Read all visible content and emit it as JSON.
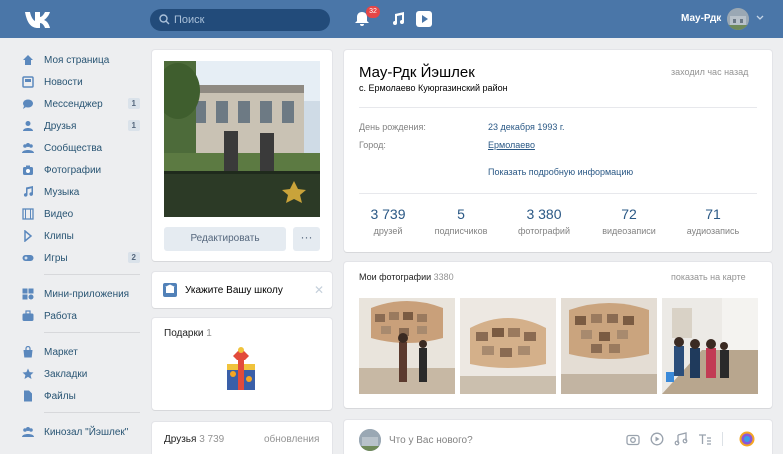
{
  "header": {
    "logo": "vk-logo",
    "search_placeholder": "Поиск",
    "notification_count": "32",
    "user_name": "Мау-Рдк"
  },
  "sidebar": {
    "items": [
      {
        "label": "Моя страница",
        "icon": "home-icon"
      },
      {
        "label": "Новости",
        "icon": "news-icon"
      },
      {
        "label": "Мессенджер",
        "icon": "message-icon",
        "count": "1"
      },
      {
        "label": "Друзья",
        "icon": "friends-icon",
        "count": "1"
      },
      {
        "label": "Сообщества",
        "icon": "communities-icon"
      },
      {
        "label": "Фотографии",
        "icon": "camera-icon"
      },
      {
        "label": "Музыка",
        "icon": "music-icon"
      },
      {
        "label": "Видео",
        "icon": "video-icon"
      },
      {
        "label": "Клипы",
        "icon": "clips-icon"
      },
      {
        "label": "Игры",
        "icon": "games-icon",
        "count": "2"
      },
      {
        "label": "Мини-приложения",
        "icon": "apps-icon"
      },
      {
        "label": "Работа",
        "icon": "briefcase-icon"
      },
      {
        "label": "Маркет",
        "icon": "market-icon"
      },
      {
        "label": "Закладки",
        "icon": "star-icon"
      },
      {
        "label": "Файлы",
        "icon": "file-icon"
      },
      {
        "label": "Кинозал \"Йэшлек\"",
        "icon": "group-icon"
      }
    ]
  },
  "left_column": {
    "edit_button": "Редактировать",
    "more_button": "···",
    "school_prompt": "Укажите Вашу школу",
    "gifts": {
      "label": "Подарки",
      "count": "1"
    },
    "friends": {
      "label": "Друзья",
      "count": "3 739",
      "updates": "обновления"
    }
  },
  "profile": {
    "name": "Мау-Рдк Йэшлек",
    "location": "с. Ермолаево Куюргазинский район",
    "last_seen": "заходил час назад",
    "birthday_label": "День рождения:",
    "birthday_value": "23 декабря 1993 г.",
    "city_label": "Город:",
    "city_value": "Ермолаево",
    "show_more": "Показать подробную информацию"
  },
  "stats": [
    {
      "value": "3 739",
      "label": "друзей"
    },
    {
      "value": "5",
      "label": "подписчиков"
    },
    {
      "value": "3 380",
      "label": "фотографий"
    },
    {
      "value": "72",
      "label": "видеозаписи"
    },
    {
      "value": "71",
      "label": "аудиозапись"
    }
  ],
  "photos": {
    "title": "Мои фотографии",
    "count": "3380",
    "map_link": "показать на карте"
  },
  "post": {
    "prompt": "Что у Вас нового?"
  },
  "colors": {
    "header": "#4a76a8",
    "link": "#2a5885",
    "background": "#edeef0"
  }
}
